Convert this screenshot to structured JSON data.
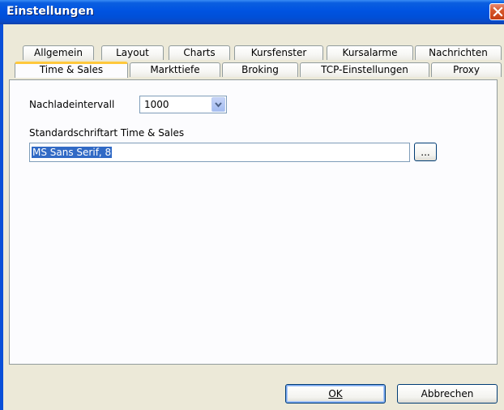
{
  "window": {
    "title": "Einstellungen"
  },
  "tabs_row1": [
    "Allgemein",
    "Layout",
    "Charts",
    "Kursfenster",
    "Kursalarme",
    "Nachrichten"
  ],
  "tabs_row2": [
    "Time & Sales",
    "Markttiefe",
    "Broking",
    "TCP-Einstellungen",
    "Proxy"
  ],
  "active_tab": "Time & Sales",
  "form": {
    "reload_label": "Nachladeintervall",
    "reload_value": "1000",
    "font_label": "Standardschriftart Time & Sales",
    "font_value": "MS Sans Serif, 8",
    "browse_label": "..."
  },
  "buttons": {
    "ok": "OK",
    "cancel": "Abbrechen"
  },
  "colors": {
    "titlebar": "#0053e1",
    "close": "#d7582c",
    "client": "#ece9d8",
    "selection": "#316ac5",
    "active_tab_accent": "#ffc83c"
  },
  "icons": {
    "close": "close-icon",
    "dropdown": "chevron-down-icon"
  }
}
